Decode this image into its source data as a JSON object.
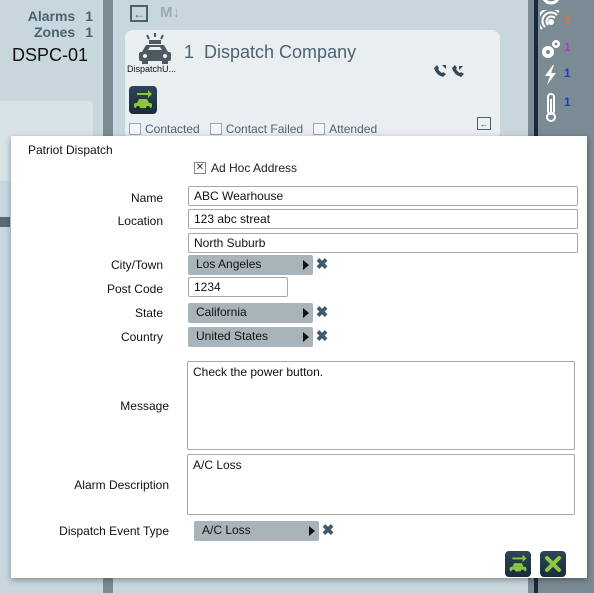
{
  "left_panel": {
    "alarms_label": "Alarms",
    "alarms_count": "1",
    "zones_label": "Zones",
    "zones_count": "1",
    "site_id": "DSPC-01"
  },
  "toolbar": {
    "back_icon": "arrow-left-box-icon",
    "markdown_label": "M↓"
  },
  "dispatch_card": {
    "unit_label": "DispatchU...",
    "index": "1",
    "title": "Dispatch Company",
    "checkboxes": [
      {
        "label": "Contacted",
        "checked": false
      },
      {
        "label": "Contact Failed",
        "checked": false
      },
      {
        "label": "Attended",
        "checked": false
      }
    ]
  },
  "status_panel": {
    "items": [
      {
        "icon": "signal-icon",
        "count": "1",
        "color": "#e8702a"
      },
      {
        "icon": "gears-icon",
        "count": "1",
        "color": "#c030c8"
      },
      {
        "icon": "lightning-icon",
        "count": "1",
        "color": "#1a3ad8"
      },
      {
        "icon": "thermometer-icon",
        "count": "1",
        "color": "#1a3ad8"
      }
    ]
  },
  "dialog": {
    "title": "Patriot Dispatch",
    "adhoc_label": "Ad Hoc Address",
    "adhoc_mark": "✕",
    "name_label": "Name",
    "name_value": "ABC Wearhouse",
    "location_label": "Location",
    "location_value": "123 abc streat",
    "location2_value": "North Suburb",
    "city_label": "City/Town",
    "city_value": "Los Angeles",
    "postcode_label": "Post Code",
    "postcode_value": "1234",
    "state_label": "State",
    "state_value": "California",
    "country_label": "Country",
    "country_value": "United States",
    "message_label": "Message",
    "message_value": "Check the power button.",
    "alarm_desc_label": "Alarm Description",
    "alarm_desc_value": "A/C Loss",
    "event_type_label": "Dispatch Event Type",
    "event_type_value": "A/C Loss",
    "clear_glyph": "✖"
  }
}
